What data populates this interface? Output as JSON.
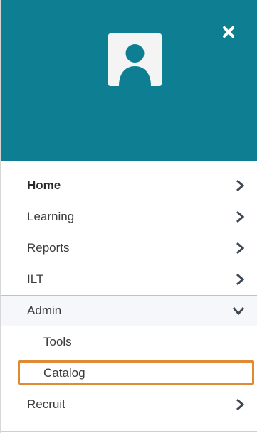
{
  "menu": {
    "items": [
      {
        "label": "Home"
      },
      {
        "label": "Learning"
      },
      {
        "label": "Reports"
      },
      {
        "label": "ILT"
      },
      {
        "label": "Admin"
      },
      {
        "label": "Tools"
      },
      {
        "label": "Catalog"
      },
      {
        "label": "Recruit"
      }
    ]
  },
  "icons": {
    "avatar": "user-silhouette",
    "close": "close-x",
    "chevron_collapsed": "chevron-right",
    "chevron_expanded": "chevron-down"
  },
  "colors": {
    "header_bg": "#0e7f93",
    "highlight_border": "#e08a33",
    "text": "#3b3b3b"
  }
}
